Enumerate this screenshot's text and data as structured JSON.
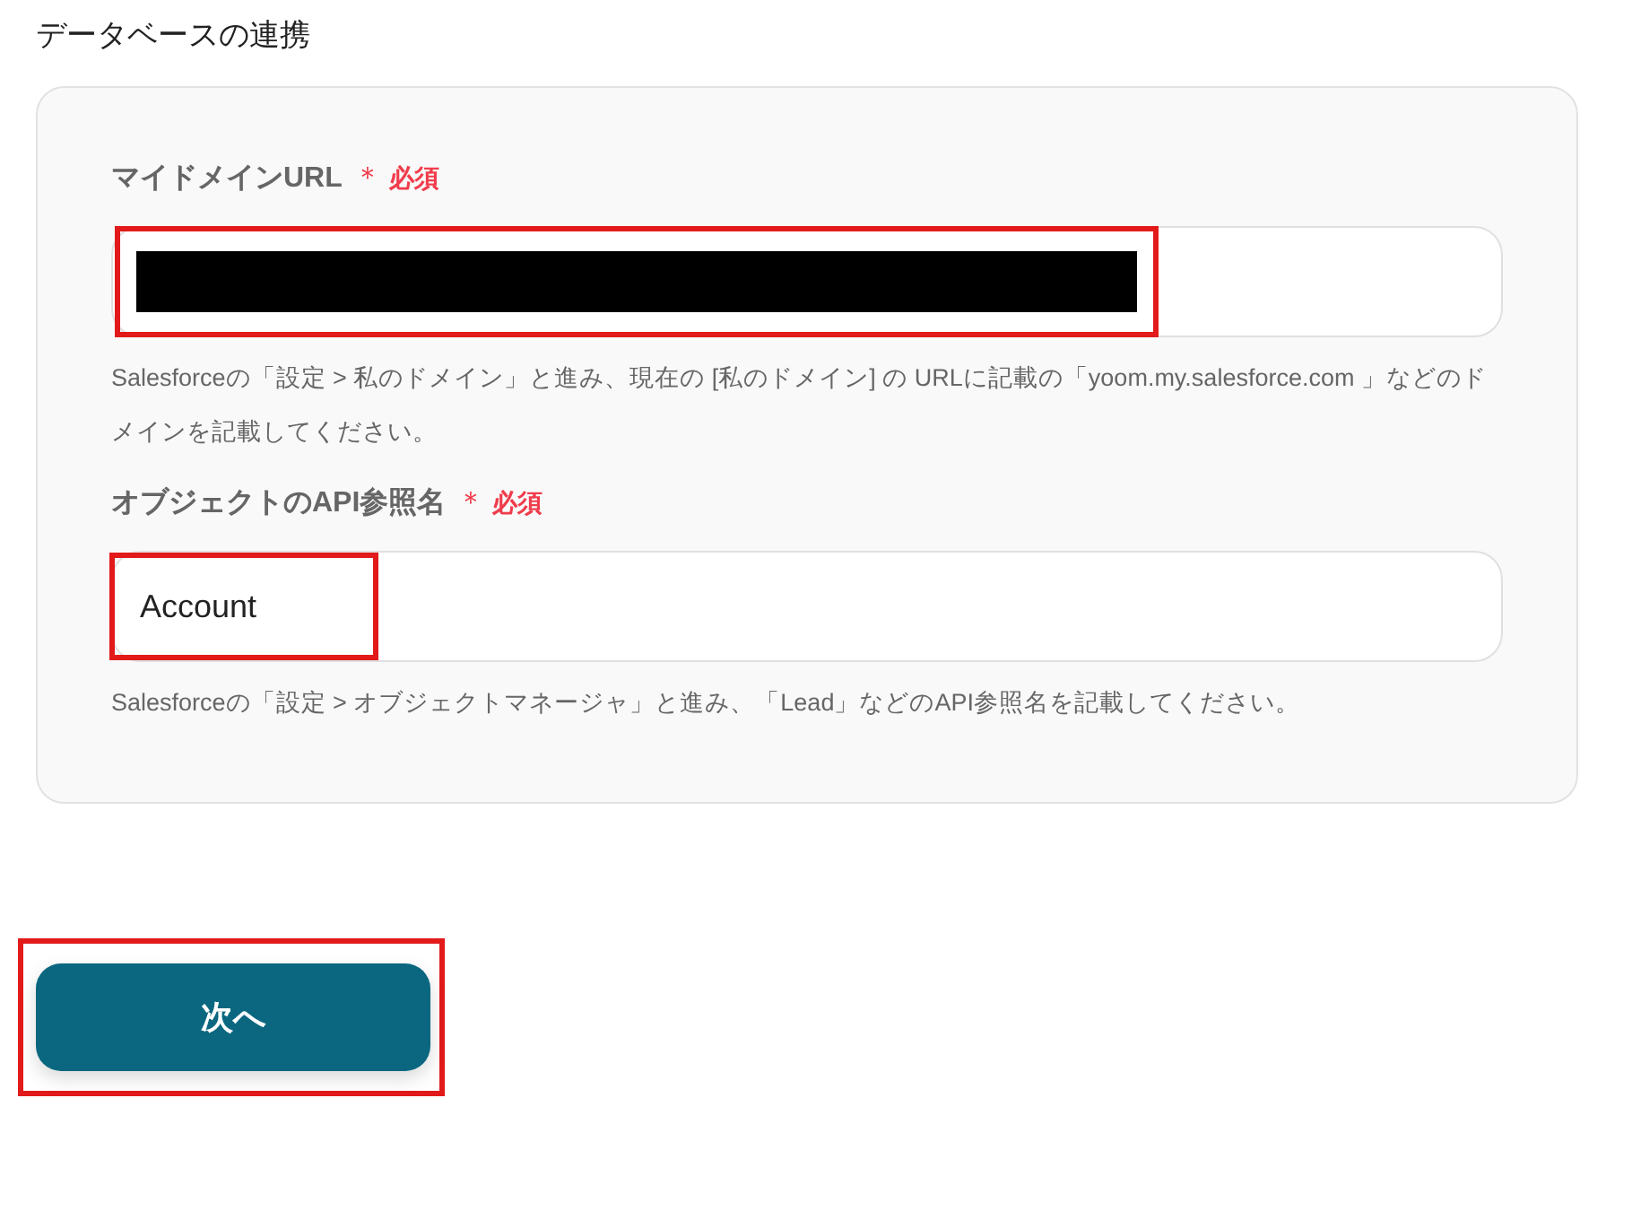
{
  "section_title": "データベースの連携",
  "fields": [
    {
      "label": "マイドメインURL",
      "required_mark": "＊",
      "required_text": "必須",
      "kind": "redacted",
      "highlighted": true,
      "help": "Salesforceの「設定 > 私のドメイン」と進み、現在の [私のドメイン] の URLに記載の「yoom.my.salesforce.com 」などのドメインを記載してください。"
    },
    {
      "label": "オブジェクトのAPI参照名",
      "required_mark": "＊",
      "required_text": "必須",
      "kind": "text",
      "value": "Account",
      "highlighted": true,
      "help": "Salesforceの「設定 > オブジェクトマネージャ」と進み、「Lead」などのAPI参照名を記載してください。"
    }
  ],
  "next_button": {
    "label": "次へ",
    "highlighted": true
  }
}
